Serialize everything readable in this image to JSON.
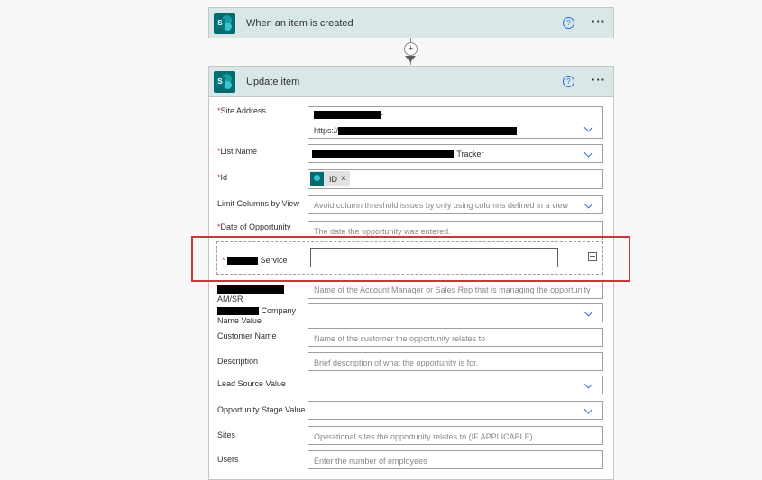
{
  "trigger": {
    "title": "When an item is created",
    "help_label": "?",
    "more_label": "···"
  },
  "connector": {
    "plus_label": "+"
  },
  "action": {
    "title": "Update item",
    "help_label": "?",
    "more_label": "···",
    "required_mark": "*",
    "fields": {
      "site_address": {
        "label": "Site Address",
        "value_prefix_line2": "https://",
        "value_suffix_line1": "-"
      },
      "list_name": {
        "label": "List Name",
        "value_suffix": "Tracker"
      },
      "id": {
        "label": "Id",
        "token_label": "ID",
        "token_remove": "×"
      },
      "limit_columns": {
        "label": "Limit Columns by View",
        "placeholder": "Avoid column threshold issues by only using columns defined in a view"
      },
      "date_of_opportunity": {
        "label": "Date of Opportunity",
        "placeholder": "The date the opportunity was entered."
      },
      "service": {
        "label_suffix": "Service"
      },
      "am_sr": {
        "label_line2": "AM/SR",
        "placeholder": "Name of the Account Manager or Sales Rep that is managing the opportunity"
      },
      "company": {
        "label_suffix": "Company",
        "label_line2": "Name Value"
      },
      "customer_name": {
        "label": "Customer Name",
        "placeholder": "Name of the customer the opportunity relates to"
      },
      "description": {
        "label": "Description",
        "placeholder": "Brief description of what the opportunity is for."
      },
      "lead_source": {
        "label": "Lead Source Value"
      },
      "opportunity_stage": {
        "label": "Opportunity Stage Value"
      },
      "sites": {
        "label": "Sites",
        "placeholder": "Operational sites the opportunity relates to (IF APPLICABLE)"
      },
      "users": {
        "label": "Users",
        "placeholder": "Enter the number of employees"
      }
    }
  },
  "colors": {
    "accent": "#2b6cd8",
    "header_bg": "#d9e7e8",
    "sharepoint": "#036c70",
    "highlight": "#d13438"
  }
}
